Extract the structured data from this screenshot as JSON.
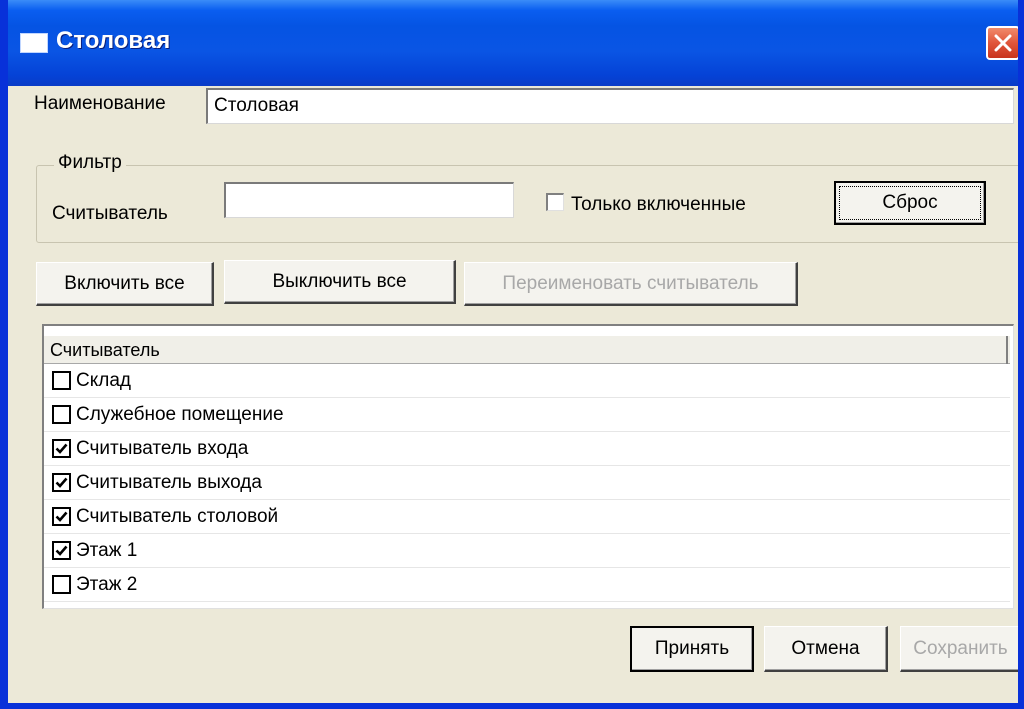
{
  "window": {
    "title": "Столовая"
  },
  "form": {
    "name_label": "Наименование",
    "name_value": "Столовая"
  },
  "filter": {
    "legend": "Фильтр",
    "reader_label": "Считыватель",
    "reader_value": "",
    "only_enabled_label": "Только включенные",
    "only_enabled_checked": false,
    "reset_label": "Сброс"
  },
  "actions": {
    "enable_all": "Включить все",
    "disable_all": "Выключить все",
    "rename_reader": "Переименовать считыватель"
  },
  "list": {
    "column_header": "Считыватель",
    "items": [
      {
        "label": "Склад",
        "checked": false
      },
      {
        "label": "Служебное помещение",
        "checked": false
      },
      {
        "label": "Считыватель входа",
        "checked": true
      },
      {
        "label": "Считыватель выхода",
        "checked": true
      },
      {
        "label": "Считыватель столовой",
        "checked": true
      },
      {
        "label": "Этаж 1",
        "checked": true
      },
      {
        "label": "Этаж 2",
        "checked": false
      }
    ]
  },
  "footer": {
    "accept": "Принять",
    "cancel": "Отмена",
    "save": "Сохранить"
  }
}
